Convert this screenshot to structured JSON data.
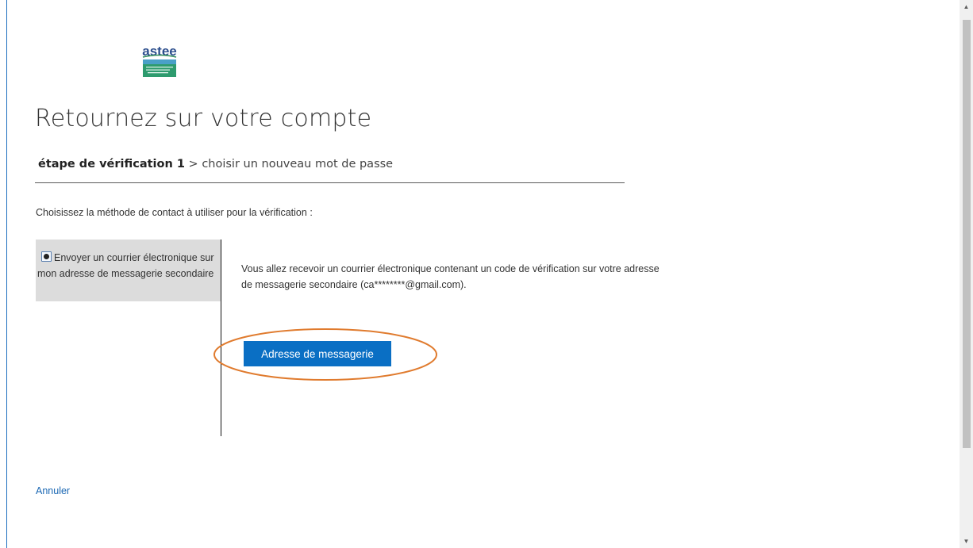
{
  "logo": {
    "text": "astee",
    "icon": "astee-logo"
  },
  "page": {
    "title": "Retournez sur votre compte",
    "breadcrumb": {
      "step1": "étape de vérification 1",
      "separator": ">",
      "step2": "choisir un nouveau mot de passe"
    },
    "instruction": "Choisissez la méthode de contact à utiliser pour la vérification :"
  },
  "method": {
    "option_label": "Envoyer un courrier électronique sur mon adresse de messagerie secondaire",
    "selected": true,
    "description": "Vous allez recevoir un courrier électronique contenant un code de vérification sur votre adresse de messagerie secondaire (ca********@gmail.com)."
  },
  "actions": {
    "primary_label": "Adresse de messagerie",
    "cancel_label": "Annuler"
  },
  "colors": {
    "primary": "#0a6fc4",
    "link": "#1a67b3",
    "highlight": "#e07b2e",
    "panel": "#dcdcdc"
  }
}
